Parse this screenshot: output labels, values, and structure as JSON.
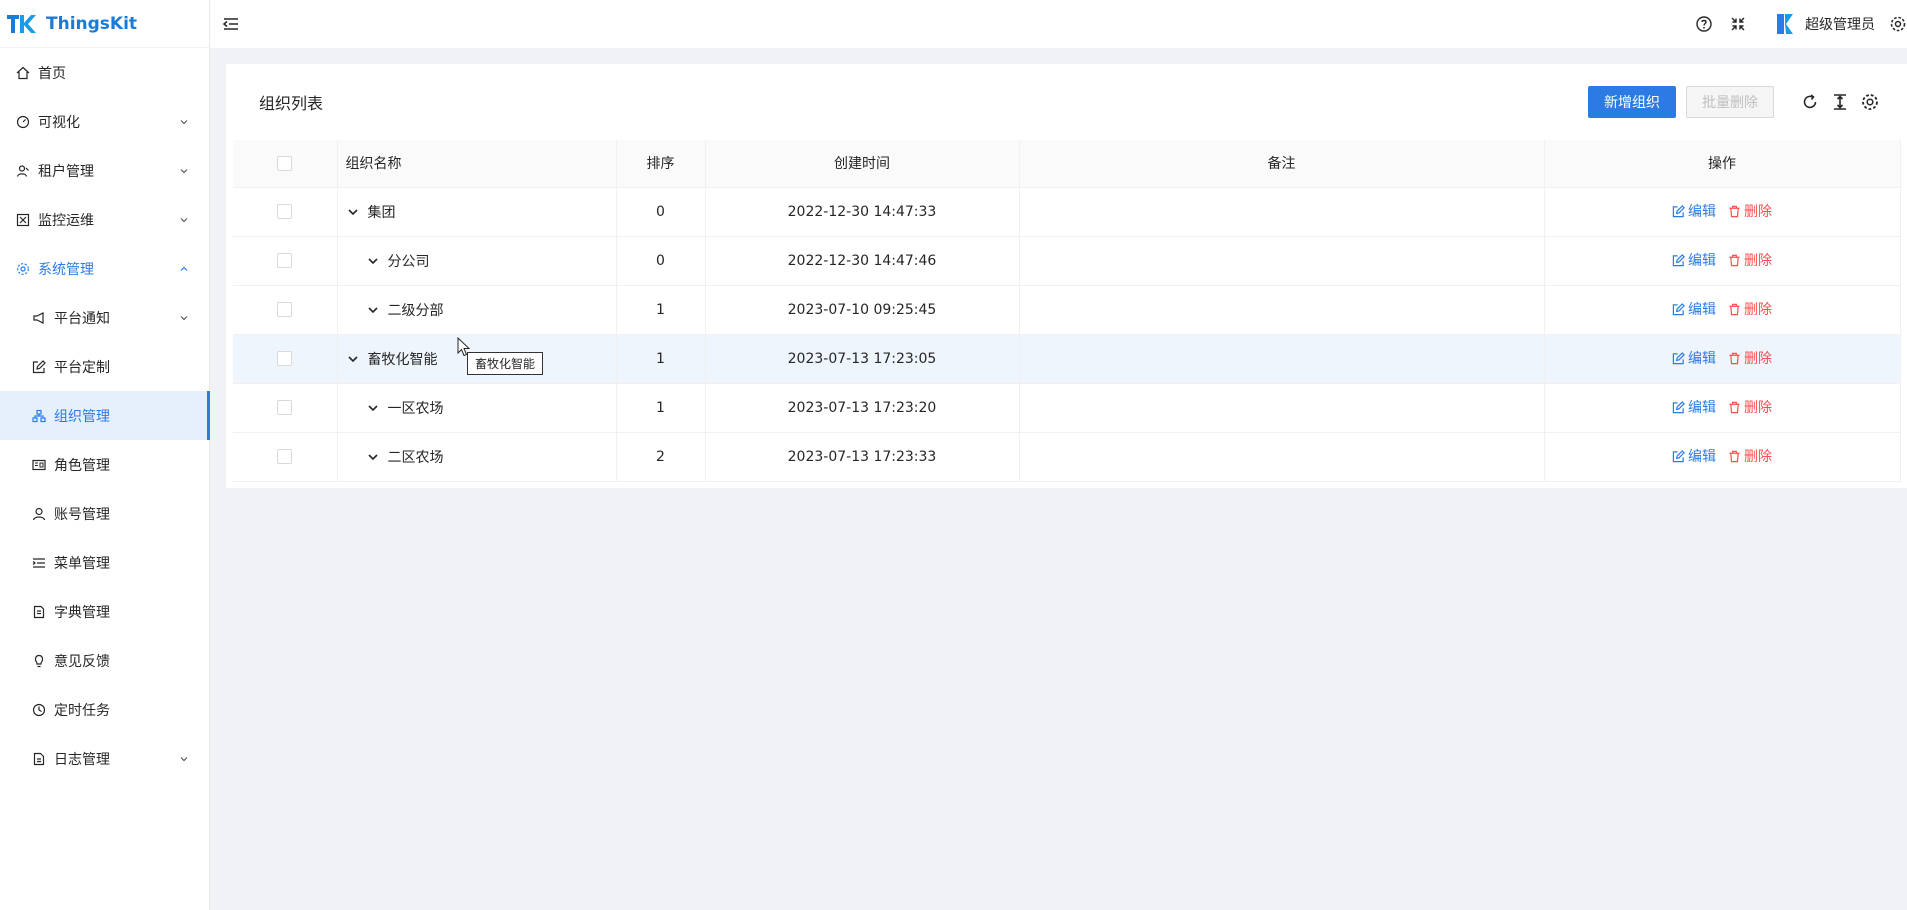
{
  "app": {
    "name": "ThingsKit"
  },
  "sidebar": {
    "items": [
      {
        "label": "首页",
        "icon": "home-icon"
      },
      {
        "label": "可视化",
        "icon": "dashboard-icon"
      },
      {
        "label": "租户管理",
        "icon": "tenant-icon"
      },
      {
        "label": "监控运维",
        "icon": "monitor-icon"
      },
      {
        "label": "系统管理",
        "icon": "gear-icon"
      },
      {
        "label": "平台通知",
        "icon": "megaphone-icon"
      },
      {
        "label": "平台定制",
        "icon": "edit-icon"
      },
      {
        "label": "组织管理",
        "icon": "org-icon"
      },
      {
        "label": "角色管理",
        "icon": "id-card-icon"
      },
      {
        "label": "账号管理",
        "icon": "user-icon"
      },
      {
        "label": "菜单管理",
        "icon": "menu-icon"
      },
      {
        "label": "字典管理",
        "icon": "book-icon"
      },
      {
        "label": "意见反馈",
        "icon": "bulb-icon"
      },
      {
        "label": "定时任务",
        "icon": "clock-icon"
      },
      {
        "label": "日志管理",
        "icon": "file-icon"
      }
    ]
  },
  "header": {
    "user_name": "超级管理员"
  },
  "main": {
    "title": "组织列表",
    "add_button": "新增组织",
    "batch_delete_button": "批量删除",
    "columns": [
      "组织名称",
      "排序",
      "创建时间",
      "备注",
      "操作"
    ],
    "rows": [
      {
        "name": "集团",
        "sort": "0",
        "created": "2022-12-30 14:47:33",
        "note": "",
        "level": 0
      },
      {
        "name": "分公司",
        "sort": "0",
        "created": "2022-12-30 14:47:46",
        "note": "",
        "level": 1
      },
      {
        "name": "二级分部",
        "sort": "1",
        "created": "2023-07-10 09:25:45",
        "note": "",
        "level": 1
      },
      {
        "name": "畜牧化智能",
        "sort": "1",
        "created": "2023-07-13 17:23:05",
        "note": "",
        "level": 0
      },
      {
        "name": "一区农场",
        "sort": "1",
        "created": "2023-07-13 17:23:20",
        "note": "",
        "level": 1
      },
      {
        "name": "二区农场",
        "sort": "2",
        "created": "2023-07-13 17:23:33",
        "note": "",
        "level": 1
      }
    ],
    "edit_label": "编辑",
    "delete_label": "删除",
    "tooltip": "畜牧化智能"
  },
  "colors": {
    "primary": "#2c7be5",
    "danger": "#ff4d4f"
  }
}
